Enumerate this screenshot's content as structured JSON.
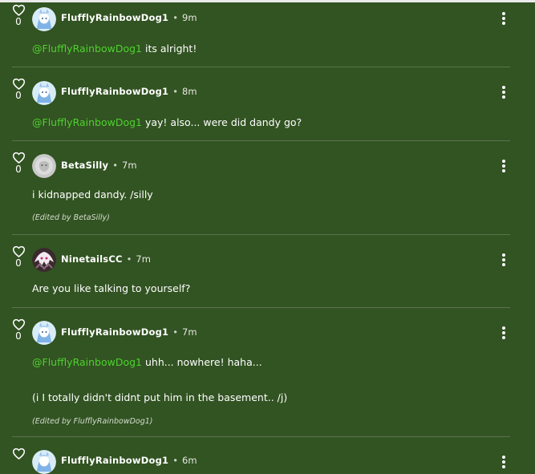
{
  "colors": {
    "background": "#325322",
    "mention": "#4ed12f",
    "divider": "#5b7450"
  },
  "icons": {
    "like": "heart-outline-icon",
    "menu": "vertical-ellipsis-icon"
  },
  "comments": [
    {
      "like_count": "0",
      "username": "FlufflyRainbowDog1",
      "separator": "•",
      "time": "9m",
      "mention": "@FlufflyRainbowDog1",
      "text": " its alright!"
    },
    {
      "like_count": "0",
      "username": "FlufflyRainbowDog1",
      "separator": "•",
      "time": "8m",
      "mention": "@FlufflyRainbowDog1",
      "text": " yay! also... were did dandy go?"
    },
    {
      "like_count": "0",
      "username": "BetaSilly",
      "separator": "•",
      "time": "7m",
      "text": "i kidnapped dandy. /silly",
      "edited": "(Edited by BetaSilly)"
    },
    {
      "like_count": "0",
      "username": "NinetailsCC",
      "separator": "•",
      "time": "7m",
      "text": "Are you like talking to yourself?"
    },
    {
      "like_count": "0",
      "username": "FlufflyRainbowDog1",
      "separator": "•",
      "time": "7m",
      "mention": "@FlufflyRainbowDog1",
      "text": " uhh... nowhere! haha...",
      "text2": "(i I totally didn't didnt put him in the basement.. /j)",
      "edited": "(Edited by FlufflyRainbowDog1)"
    },
    {
      "username": "FlufflyRainbowDog1",
      "separator": "•",
      "time": "6m"
    }
  ]
}
